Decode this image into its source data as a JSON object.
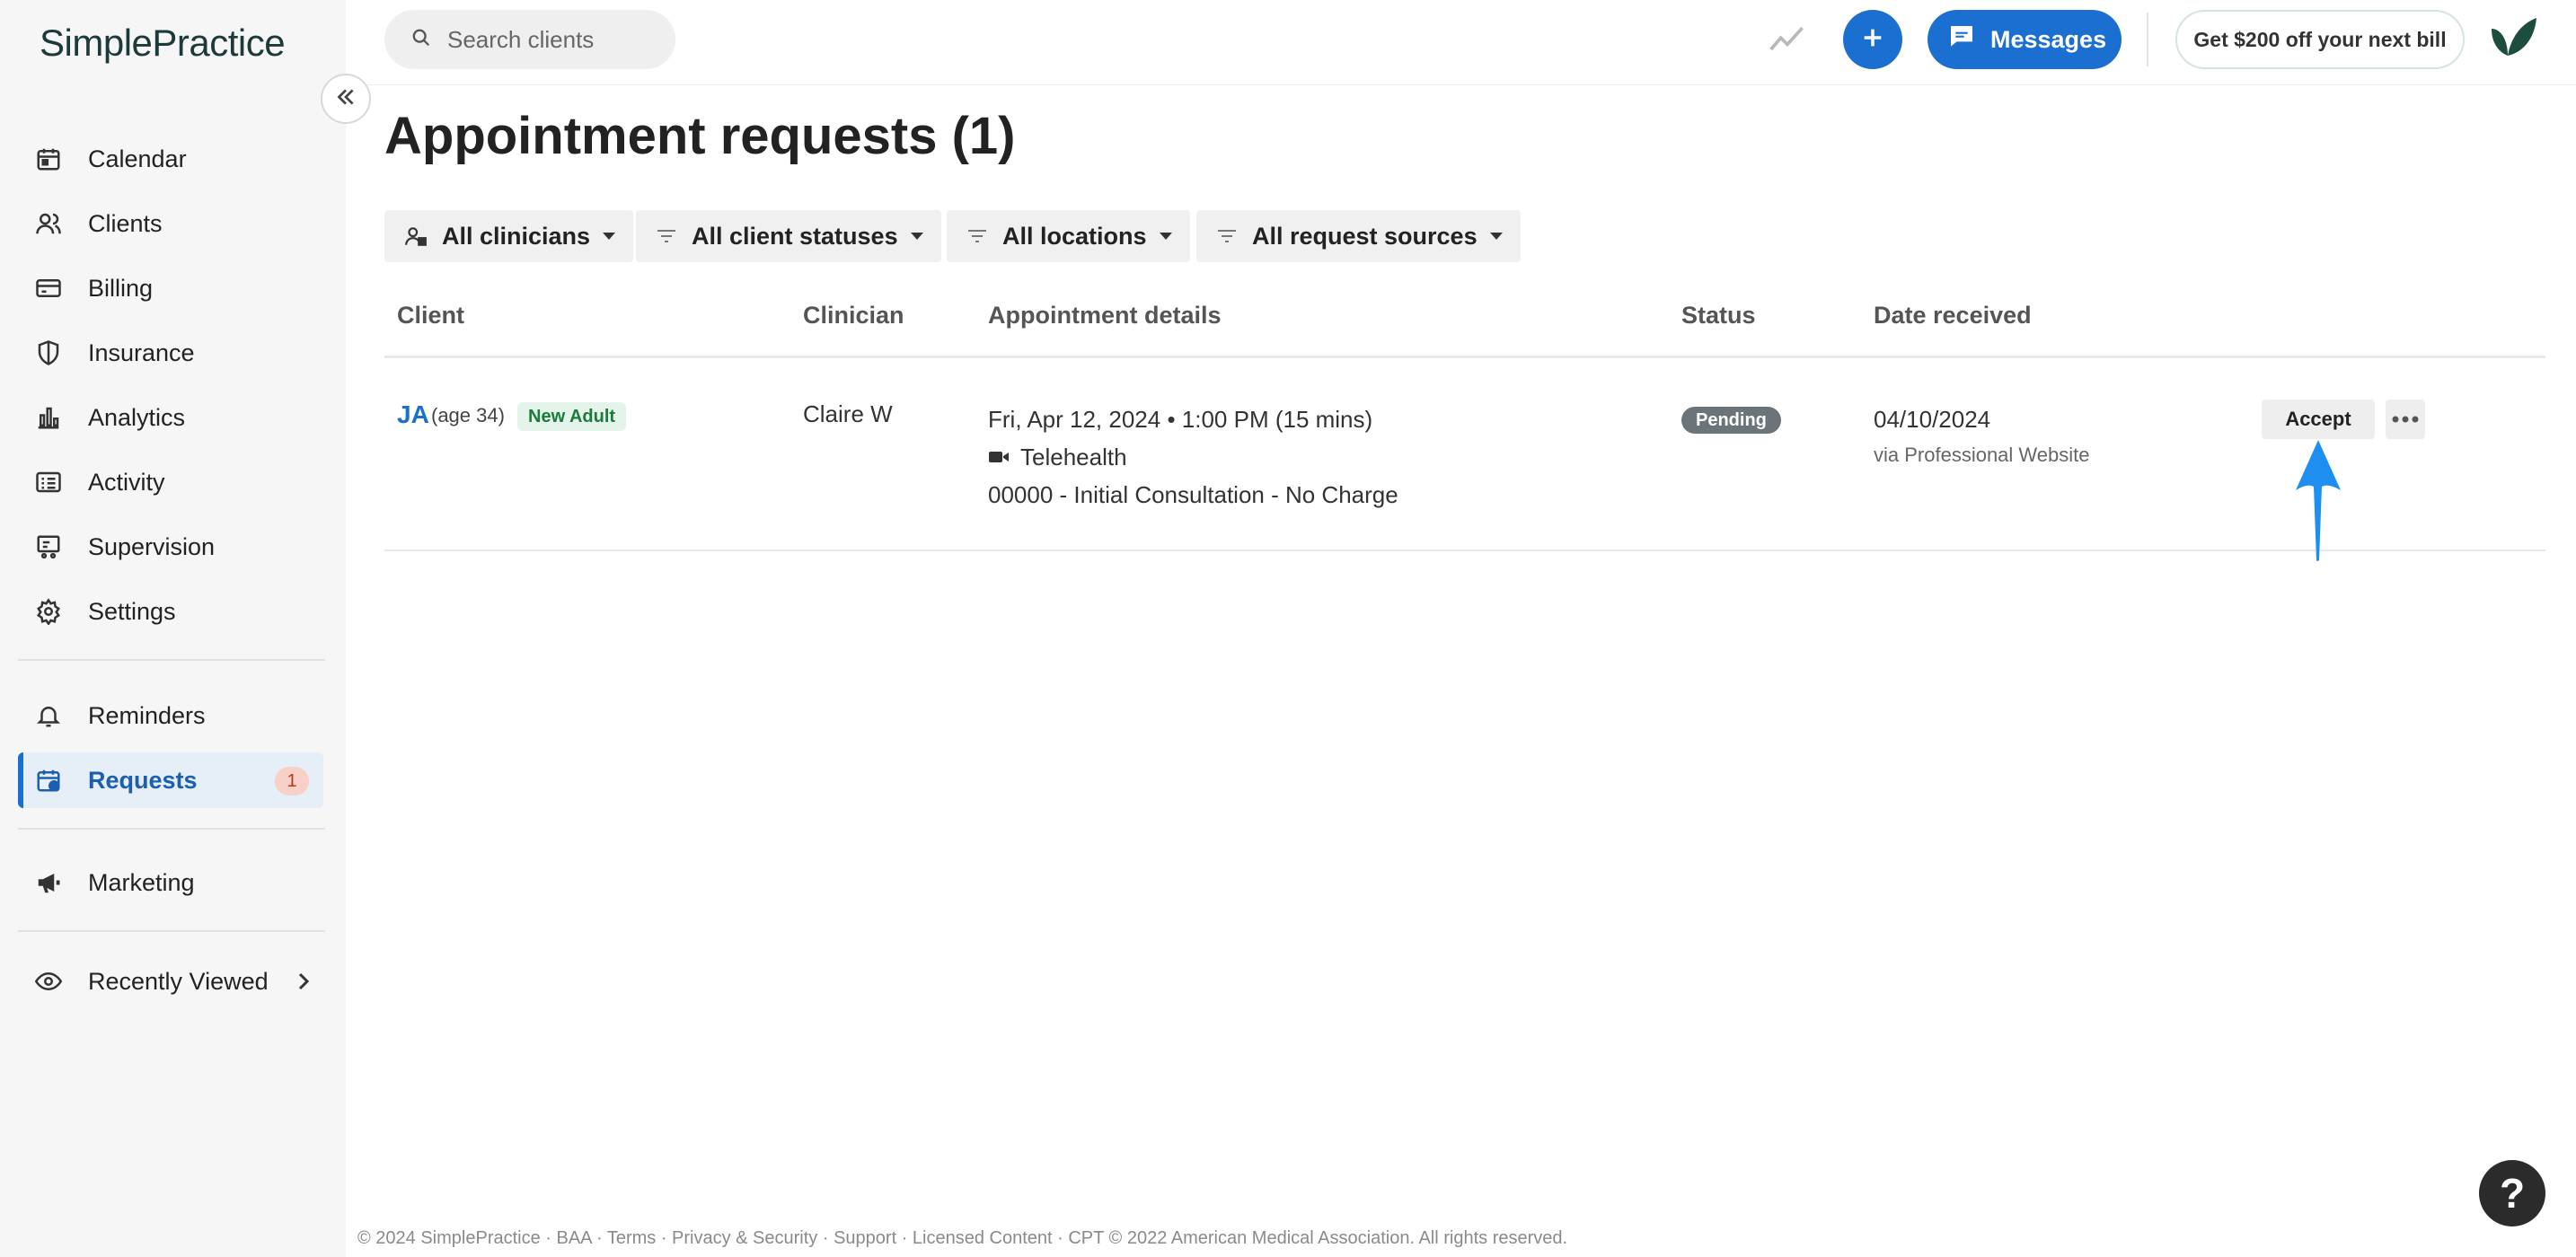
{
  "brand": {
    "name": "SimplePractice"
  },
  "sidebar": {
    "items": [
      {
        "label": "Calendar",
        "icon": "calendar-icon"
      },
      {
        "label": "Clients",
        "icon": "clients-icon"
      },
      {
        "label": "Billing",
        "icon": "billing-icon"
      },
      {
        "label": "Insurance",
        "icon": "shield-icon"
      },
      {
        "label": "Analytics",
        "icon": "bar-chart-icon"
      },
      {
        "label": "Activity",
        "icon": "list-icon"
      },
      {
        "label": "Supervision",
        "icon": "supervision-icon"
      },
      {
        "label": "Settings",
        "icon": "gear-icon"
      },
      {
        "label": "Reminders",
        "icon": "bell-icon"
      },
      {
        "label": "Requests",
        "icon": "calendar-request-icon",
        "badge": "1",
        "active": true
      },
      {
        "label": "Marketing",
        "icon": "megaphone-icon"
      },
      {
        "label": "Recently Viewed",
        "icon": "eye-icon"
      }
    ]
  },
  "header": {
    "search_placeholder": "Search clients",
    "messages_label": "Messages",
    "promo_label": "Get $200 off your next bill"
  },
  "main": {
    "title": "Appointment requests (1)",
    "filters": [
      {
        "label": "All clinicians"
      },
      {
        "label": "All client statuses"
      },
      {
        "label": "All locations"
      },
      {
        "label": "All request sources"
      }
    ],
    "columns": [
      "Client",
      "Clinician",
      "Appointment details",
      "Status",
      "Date received"
    ],
    "rows": [
      {
        "client_initials": "JA",
        "client_age": "(age 34)",
        "client_tag": "New Adult",
        "clinician": "Claire W",
        "appt_datetime": "Fri, Apr 12, 2024 • 1:00 PM (15 mins)",
        "appt_location": "Telehealth",
        "appt_service": "00000 - Initial Consultation - No Charge",
        "status": "Pending",
        "date_received": "04/10/2024",
        "source": "via Professional Website",
        "accept_label": "Accept"
      }
    ]
  },
  "footer": {
    "text": "© 2024 SimplePractice · BAA · Terms · Privacy & Security · Support · Licensed Content · CPT © 2022 American Medical Association. All rights reserved."
  },
  "help": {
    "label": "?"
  },
  "colors": {
    "accent": "#1b6fd1",
    "annotation_arrow": "#1e8ff0"
  }
}
